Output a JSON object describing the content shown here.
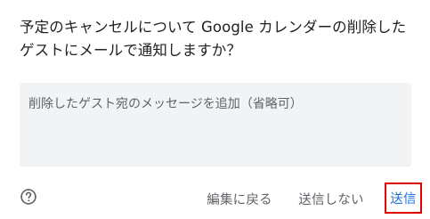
{
  "dialog": {
    "title": "予定のキャンセルについて Google カレンダーの削除したゲストにメールで通知しますか？",
    "message_placeholder": "削除したゲスト宛のメッセージを追加（省略可）",
    "message_value": ""
  },
  "footer": {
    "help_icon": "help-circle-icon",
    "back_to_edit_label": "編集に戻る",
    "dont_send_label": "送信しない",
    "send_label": "送信"
  },
  "colors": {
    "primary": "#1a73e8",
    "text": "#202124",
    "secondary_text": "#5f6368",
    "field_bg": "#f1f3f4",
    "highlight_border": "#e00000"
  }
}
